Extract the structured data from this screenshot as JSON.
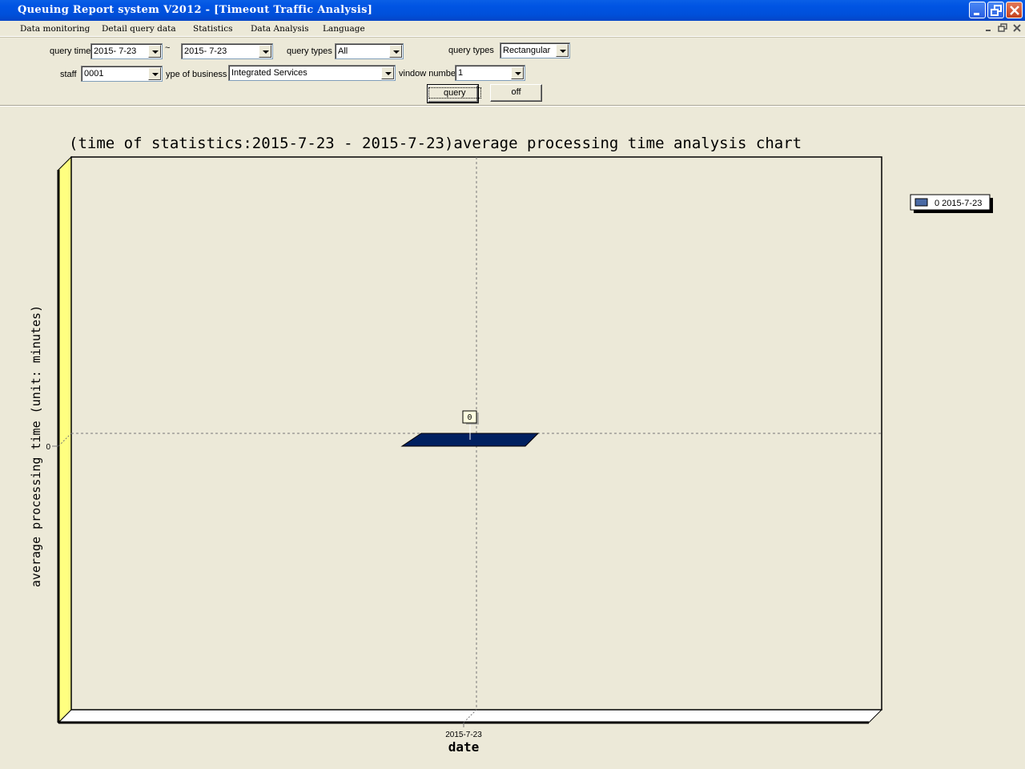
{
  "window": {
    "title": "Queuing Report system V2012 - [Timeout Traffic Analysis]",
    "controls": [
      "minimize",
      "restore",
      "close"
    ]
  },
  "menu": {
    "items": [
      "Data monitoring",
      "Detail query data",
      "Statistics",
      "Data Analysis",
      "Language"
    ]
  },
  "filters": {
    "query_time_label": "query time",
    "query_time_from": "2015-  7-23",
    "range_separator": "~",
    "query_time_to": "2015-  7-23",
    "query_types_label": "query types",
    "query_types_value": "All",
    "chart_types_label": "query types",
    "chart_types_value": "Rectangular",
    "staff_label": "staff",
    "staff_value": "0001",
    "business_label": "ype of business",
    "business_value": "Integrated Services",
    "window_number_label": "vindow number",
    "window_number_value": "1",
    "query_button": "query",
    "off_button": "off"
  },
  "colors": {
    "titlebar": "#0054e3",
    "background": "#ece9d8",
    "bar": "#002060",
    "y_wall": "#ffff80",
    "legend_swatch": "#4a6aa5"
  },
  "chart_data": {
    "type": "bar",
    "title": "(time of statistics:2015-7-23 -  2015-7-23)average processing time analysis chart",
    "xlabel": "date",
    "ylabel": "average processing time (unit: minutes)",
    "categories": [
      "2015-7-23"
    ],
    "series": [
      {
        "name": "0 2015-7-23",
        "values": [
          0
        ]
      }
    ],
    "data_labels": [
      "0"
    ],
    "y_ticks": [
      "0"
    ],
    "ylim": [
      -1,
      1
    ],
    "grid": true,
    "legend_position": "top-right",
    "style": "3d"
  }
}
